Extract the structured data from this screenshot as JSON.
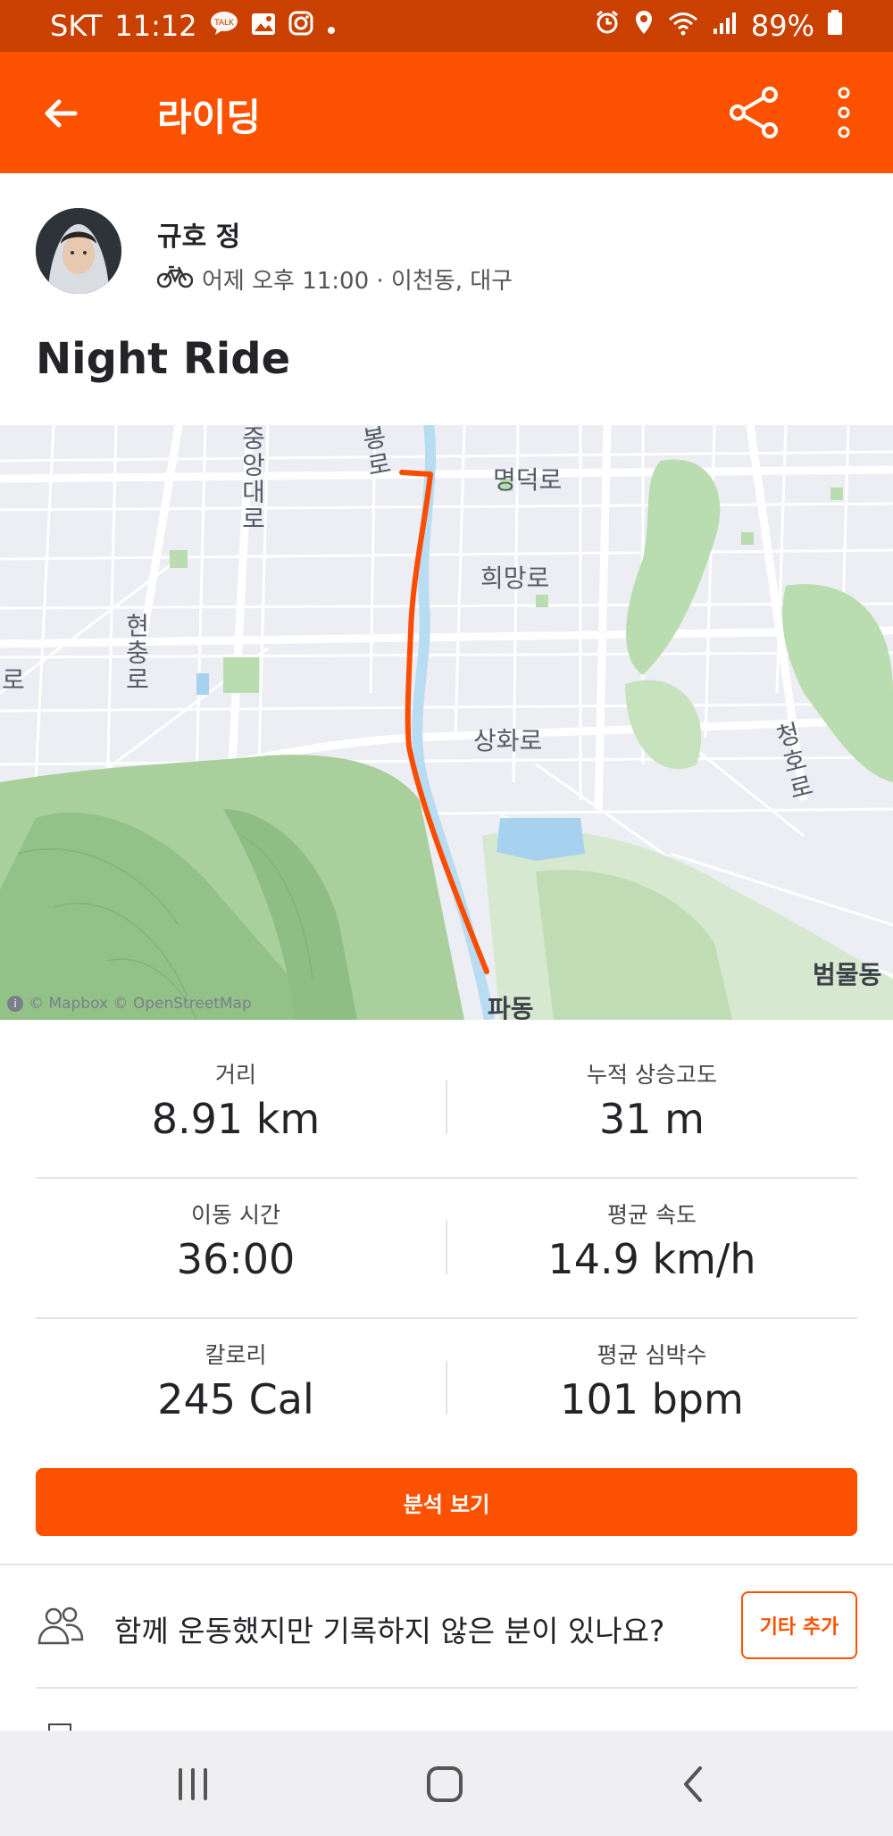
{
  "status_bar": {
    "carrier": "SKT",
    "time": "11:12",
    "battery": "89%",
    "left_icons": [
      "talk-icon",
      "gallery-icon",
      "instagram-icon",
      "dot-icon"
    ],
    "right_icons": [
      "alarm-icon",
      "location-icon",
      "wifi-icon",
      "signal-icon",
      "battery-icon"
    ]
  },
  "app_bar": {
    "title": "라이딩",
    "icons": [
      "back-arrow-icon",
      "share-icon",
      "more-vertical-icon"
    ]
  },
  "athlete": {
    "name": "규호 정",
    "meta": "어제 오후 11:00 · 이천동, 대구",
    "activity_icon": "bike-icon"
  },
  "activity": {
    "title": "Night Ride"
  },
  "map": {
    "labels": {
      "myeongdeok": "명덕로",
      "huimang": "희망로",
      "sanghwa": "상화로",
      "cheongho": "청호로",
      "hyeonchung": "현충로",
      "jungang": "중앙대로",
      "bong": "봉로",
      "ro_left": "로",
      "beommul": "범물동",
      "padong": "파동"
    },
    "attribution": "© Mapbox © OpenStreetMap",
    "route_color": "#fc4c02"
  },
  "stats": [
    {
      "label": "거리",
      "value": "8.91 km"
    },
    {
      "label": "누적 상승고도",
      "value": "31 m"
    },
    {
      "label": "이동 시간",
      "value": "36:00"
    },
    {
      "label": "평균 속도",
      "value": "14.9 km/h"
    },
    {
      "label": "칼로리",
      "value": "245 Cal"
    },
    {
      "label": "평균 심박수",
      "value": "101 bpm"
    }
  ],
  "analysis_button": {
    "label": "분석 보기"
  },
  "group_prompt": {
    "text": "함께 운동했지만 기록하지 않은 분이 있나요?",
    "button": "기타 추가",
    "icon": "people-icon"
  },
  "nav_bar": {
    "icons": [
      "recent-apps-icon",
      "home-icon",
      "back-icon"
    ]
  },
  "colors": {
    "brand": "#fc5200",
    "status_bar": "#c94000"
  }
}
